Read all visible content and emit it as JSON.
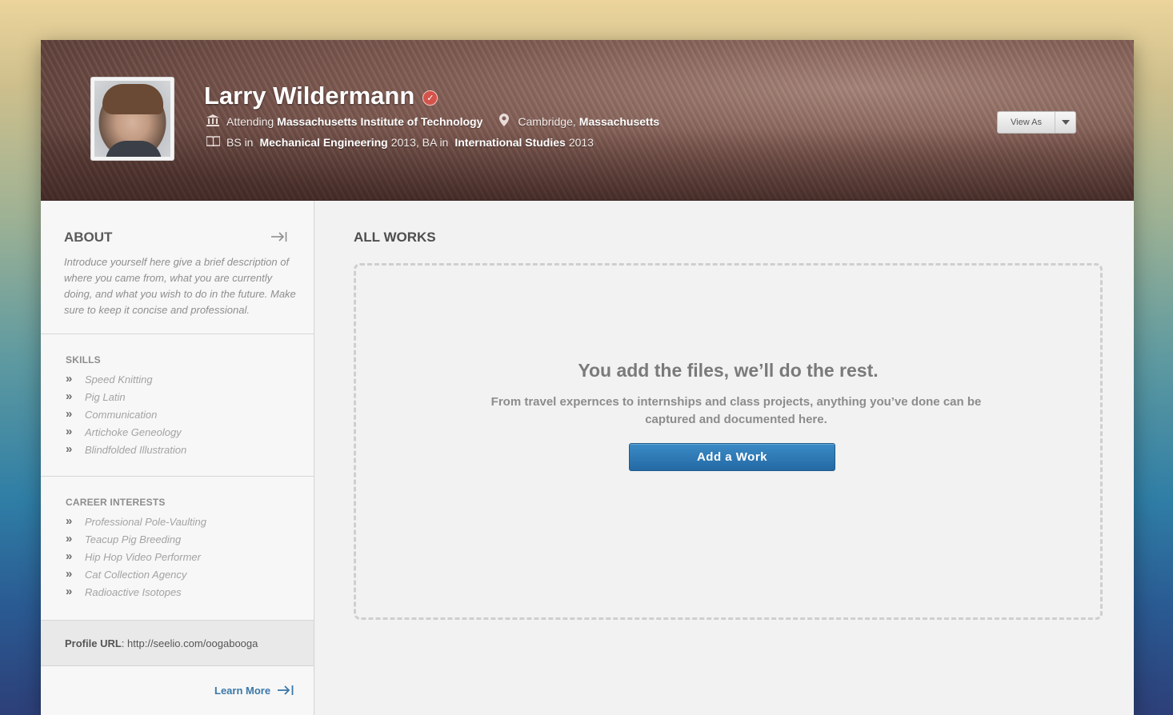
{
  "profile": {
    "name": "Larry Wildermann",
    "verified_icon": "check-circle-icon",
    "attending_prefix": "Attending",
    "school": "Massachusetts Institute of Technology",
    "city": "Cambridge,",
    "state": "Massachusetts",
    "degree1_prefix": "BS in",
    "degree1_major": "Mechanical Engineering",
    "degree1_suffix": "2013, BA in",
    "degree2_major": "International Studies",
    "degree2_year": "2013",
    "view_as_label": "View As"
  },
  "about": {
    "title": "ABOUT",
    "text": "Introduce yourself here give a brief description of where you came from, what you are currently doing, and what you wish to do in the future. Make sure to keep it concise and professional."
  },
  "skills": {
    "title": "SKILLS",
    "items": [
      "Speed Knitting",
      "Pig Latin",
      "Communication",
      "Artichoke Geneology",
      "Blindfolded Illustration"
    ]
  },
  "career_interests": {
    "title": "CAREER INTERESTS",
    "items": [
      "Professional Pole-Vaulting",
      "Teacup Pig Breeding",
      "Hip Hop Video Performer",
      "Cat Collection Agency",
      "Radioactive Isotopes"
    ]
  },
  "profile_url": {
    "label": "Profile URL",
    "value": "http://seelio.com/oogabooga"
  },
  "learn_more": "Learn More",
  "works": {
    "title": "ALL WORKS",
    "heading": "You add the files, we’ll do the rest.",
    "subtext": "From travel expernces to internships and class projects, anything you’ve done can be captured and documented here.",
    "add_button": "Add a Work"
  },
  "colors": {
    "accent_blue": "#2f7bb8",
    "verified_red": "#d4534a",
    "header_brown": "#6d4a43"
  }
}
